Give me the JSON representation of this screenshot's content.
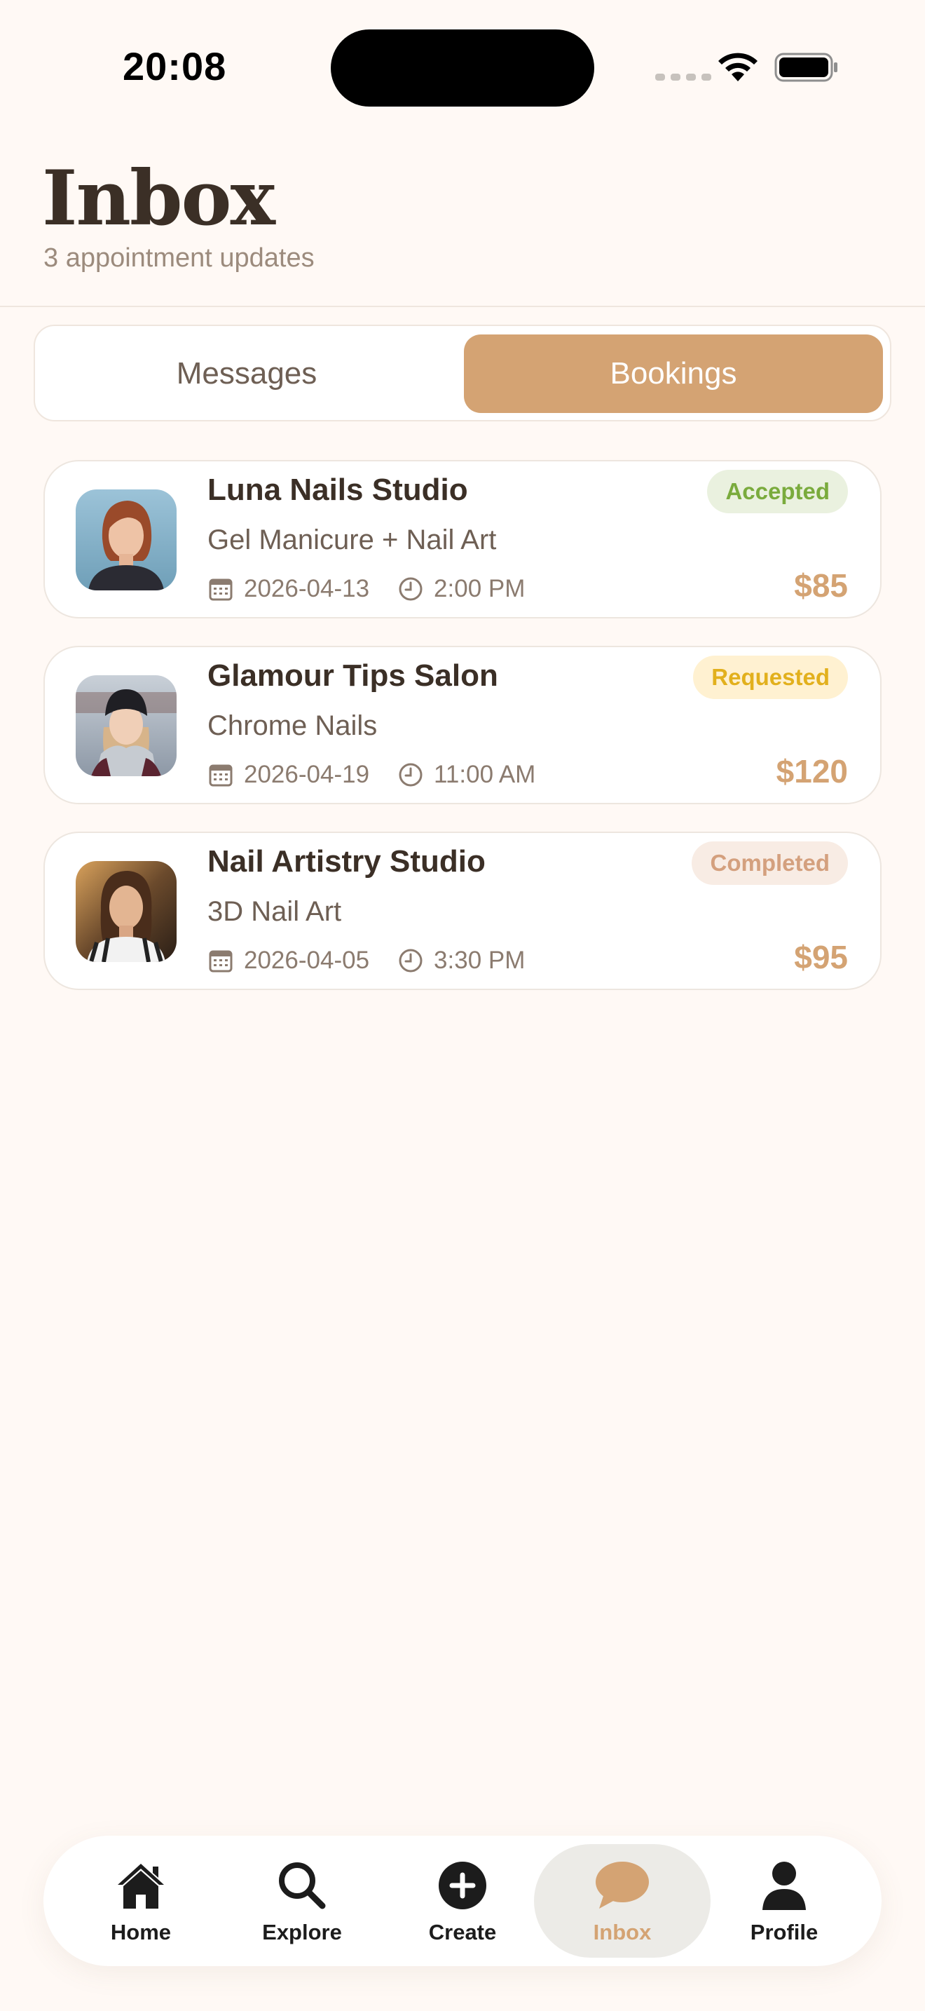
{
  "status_bar": {
    "time": "20:08"
  },
  "header": {
    "title": "Inbox",
    "subtitle": "3 appointment updates"
  },
  "segmented": {
    "tabs": [
      "Messages",
      "Bookings"
    ],
    "selected": "Bookings"
  },
  "bookings": [
    {
      "salon": "Luna Nails Studio",
      "service": "Gel Manicure + Nail Art",
      "date": "2026-04-13",
      "time": "2:00 PM",
      "status": "Accepted",
      "price": "$85"
    },
    {
      "salon": "Glamour Tips Salon",
      "service": "Chrome Nails",
      "date": "2026-04-19",
      "time": "11:00 AM",
      "status": "Requested",
      "price": "$120"
    },
    {
      "salon": "Nail Artistry Studio",
      "service": "3D Nail Art",
      "date": "2026-04-05",
      "time": "3:30 PM",
      "status": "Completed",
      "price": "$95"
    }
  ],
  "tabbar": {
    "items": [
      {
        "label": "Home",
        "icon": "home-icon"
      },
      {
        "label": "Explore",
        "icon": "search-icon"
      },
      {
        "label": "Create",
        "icon": "plus-circle-icon"
      },
      {
        "label": "Inbox",
        "icon": "chat-bubble-icon"
      },
      {
        "label": "Profile",
        "icon": "person-icon"
      }
    ],
    "active": "Inbox"
  },
  "colors": {
    "accent": "#d4a373",
    "background": "#fff9f5",
    "accepted": "#7aab3d",
    "requested": "#e2b01d",
    "completed": "#d4a07e"
  }
}
